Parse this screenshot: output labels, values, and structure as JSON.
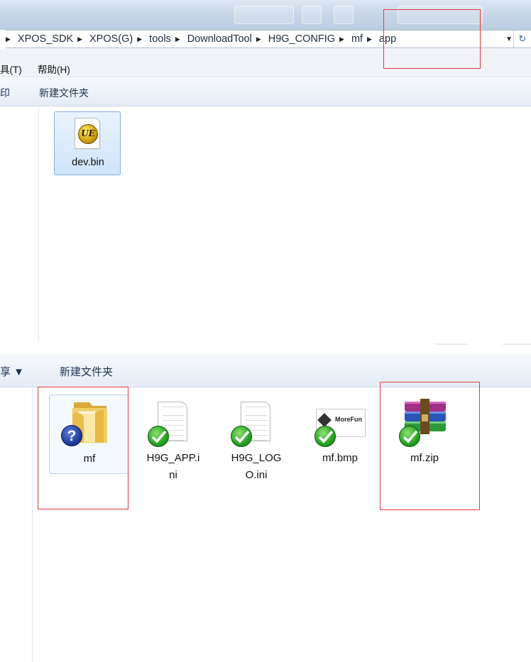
{
  "top_window": {
    "breadcrumb": [
      "XPOS_SDK",
      "XPOS(G)",
      "tools",
      "DownloadTool",
      "H9G_CONFIG",
      "mf",
      "app"
    ],
    "menu": {
      "tools_partial": "具(T)",
      "help": "帮助(H)"
    },
    "toolbar": {
      "left_partial": "印",
      "new_folder": "新建文件夹"
    },
    "files": [
      {
        "name": "dev.bin",
        "icon": "ultraedit-file-icon"
      }
    ]
  },
  "bottom_window": {
    "toolbar": {
      "share_partial": "享 ▼",
      "new_folder": "新建文件夹"
    },
    "files": [
      {
        "name": "mf",
        "icon": "folder-icon",
        "status": "question-overlay-icon"
      },
      {
        "name": "H9G_APP.ini",
        "name_lines": [
          "H9G_APP.i",
          "ni"
        ],
        "icon": "ini-document-icon",
        "status": "synced-check-icon"
      },
      {
        "name": "H9G_LOGO.ini",
        "name_lines": [
          "H9G_LOG",
          "O.ini"
        ],
        "icon": "ini-document-icon",
        "status": "synced-check-icon"
      },
      {
        "name": "mf.bmp",
        "icon": "bitmap-thumbnail-icon",
        "thumbnail_text": "MoreFun",
        "status": "synced-check-icon"
      },
      {
        "name": "mf.zip",
        "icon": "winrar-archive-icon",
        "status": "synced-check-icon"
      }
    ]
  },
  "colors": {
    "highlight": "#e33b3b",
    "selection_border": "#84acdd",
    "check_green": "#27a326",
    "question_blue": "#1d3a9c"
  }
}
